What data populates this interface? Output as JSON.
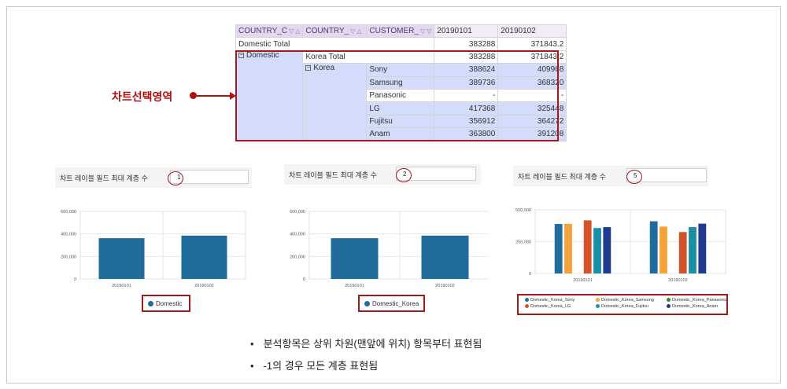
{
  "pivot": {
    "headers": [
      "COUNTRY_C",
      "COUNTRY_",
      "CUSTOMER_",
      "20190101",
      "20190102"
    ],
    "domestic_total": {
      "label": "Domestic Total",
      "v1": "383288",
      "v2": "371843.2"
    },
    "domestic": {
      "label": "Domestic",
      "korea_total": "Korea Total",
      "v1": "383288",
      "v2": "371843.2"
    },
    "korea": "Korea",
    "rows": [
      {
        "customer": "Sony",
        "v1": "388624",
        "v2": "409968"
      },
      {
        "customer": "Samsung",
        "v1": "389736",
        "v2": "368320"
      },
      {
        "customer": "Panasonic",
        "v1": "-",
        "v2": "-"
      },
      {
        "customer": "LG",
        "v1": "417368",
        "v2": "325448"
      },
      {
        "customer": "Fujitsu",
        "v1": "356912",
        "v2": "364272"
      },
      {
        "customer": "Anam",
        "v1": "363800",
        "v2": "391208"
      }
    ]
  },
  "selection_area_label": "차트선택영역",
  "settings": [
    {
      "label": "차트 레이블 필드 최대 계층 수",
      "value": "1"
    },
    {
      "label": "차트 레이블 필드 최대 계층 수",
      "value": "2"
    },
    {
      "label": "차트 레이블 필드 최대 계층 수",
      "value": "5"
    }
  ],
  "colors": {
    "bar_primary": "#1f6b9a",
    "accent_red": "#a01a1a",
    "header_purple": "#e3d7f2",
    "selection_blue": "#d3dcfa"
  },
  "chart_data": [
    {
      "type": "bar",
      "categories": [
        "20190101",
        "20190102"
      ],
      "series": [
        {
          "name": "Domestic",
          "values": [
            362000,
            385000
          ],
          "color": "#1f6b9a"
        }
      ],
      "yticks": [
        "0",
        "200,000",
        "400,000",
        "600,000"
      ],
      "ylim": [
        0,
        600000
      ],
      "grid": true,
      "legend_position": "bottom"
    },
    {
      "type": "bar",
      "categories": [
        "20190101",
        "20190102"
      ],
      "series": [
        {
          "name": "Domestic_Korea",
          "values": [
            362000,
            385000
          ],
          "color": "#1f6b9a"
        }
      ],
      "yticks": [
        "0",
        "200,000",
        "400,000",
        "600,000"
      ],
      "ylim": [
        0,
        600000
      ],
      "grid": true,
      "legend_position": "bottom"
    },
    {
      "type": "bar",
      "categories": [
        "20190101",
        "20190102"
      ],
      "series": [
        {
          "name": "Domestic_Korea_Sony",
          "values": [
            388624,
            409968
          ],
          "color": "#1f6b9a"
        },
        {
          "name": "Domestic_Korea_Samsung",
          "values": [
            389736,
            368320
          ],
          "color": "#f4a23a"
        },
        {
          "name": "Domestic_Korea_Panasonic",
          "values": [
            0,
            0
          ],
          "color": "#2e8b3a"
        },
        {
          "name": "Domestic_Korea_LG",
          "values": [
            417368,
            325448
          ],
          "color": "#d4522a"
        },
        {
          "name": "Domestic_Korea_Fujitsu",
          "values": [
            356912,
            364272
          ],
          "color": "#1a8fa6"
        },
        {
          "name": "Domestic_Korea_Anam",
          "values": [
            363800,
            391208
          ],
          "color": "#1f3a8f"
        }
      ],
      "yticks": [
        "0",
        "250,000",
        "500,000"
      ],
      "ylim": [
        0,
        500000
      ],
      "grid": true,
      "legend_position": "bottom"
    }
  ],
  "notes": [
    "분석항목은  상위 차원(맨앞에 위치) 항목부터 표현됨",
    "-1의 경우 모든 계층 표현됨"
  ]
}
